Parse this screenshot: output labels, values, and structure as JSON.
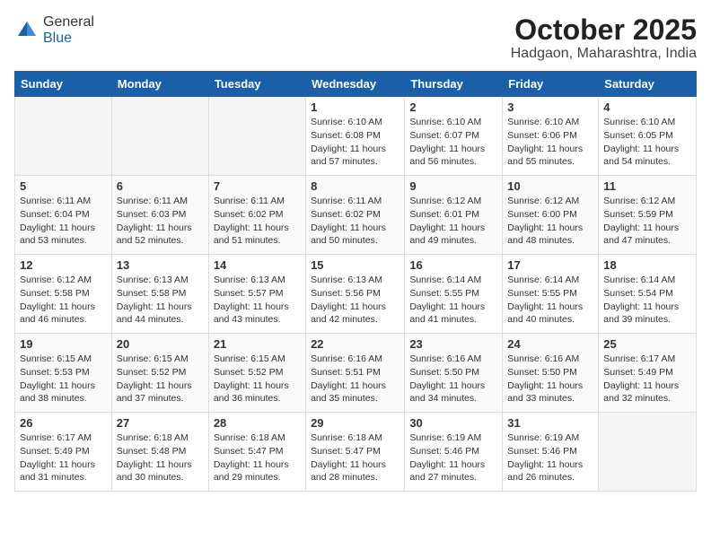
{
  "header": {
    "logo_line1": "General",
    "logo_line2": "Blue",
    "month_title": "October 2025",
    "subtitle": "Hadgaon, Maharashtra, India"
  },
  "weekdays": [
    "Sunday",
    "Monday",
    "Tuesday",
    "Wednesday",
    "Thursday",
    "Friday",
    "Saturday"
  ],
  "weeks": [
    [
      {
        "day": "",
        "info": ""
      },
      {
        "day": "",
        "info": ""
      },
      {
        "day": "",
        "info": ""
      },
      {
        "day": "1",
        "info": "Sunrise: 6:10 AM\nSunset: 6:08 PM\nDaylight: 11 hours and 57 minutes."
      },
      {
        "day": "2",
        "info": "Sunrise: 6:10 AM\nSunset: 6:07 PM\nDaylight: 11 hours and 56 minutes."
      },
      {
        "day": "3",
        "info": "Sunrise: 6:10 AM\nSunset: 6:06 PM\nDaylight: 11 hours and 55 minutes."
      },
      {
        "day": "4",
        "info": "Sunrise: 6:10 AM\nSunset: 6:05 PM\nDaylight: 11 hours and 54 minutes."
      }
    ],
    [
      {
        "day": "5",
        "info": "Sunrise: 6:11 AM\nSunset: 6:04 PM\nDaylight: 11 hours and 53 minutes."
      },
      {
        "day": "6",
        "info": "Sunrise: 6:11 AM\nSunset: 6:03 PM\nDaylight: 11 hours and 52 minutes."
      },
      {
        "day": "7",
        "info": "Sunrise: 6:11 AM\nSunset: 6:02 PM\nDaylight: 11 hours and 51 minutes."
      },
      {
        "day": "8",
        "info": "Sunrise: 6:11 AM\nSunset: 6:02 PM\nDaylight: 11 hours and 50 minutes."
      },
      {
        "day": "9",
        "info": "Sunrise: 6:12 AM\nSunset: 6:01 PM\nDaylight: 11 hours and 49 minutes."
      },
      {
        "day": "10",
        "info": "Sunrise: 6:12 AM\nSunset: 6:00 PM\nDaylight: 11 hours and 48 minutes."
      },
      {
        "day": "11",
        "info": "Sunrise: 6:12 AM\nSunset: 5:59 PM\nDaylight: 11 hours and 47 minutes."
      }
    ],
    [
      {
        "day": "12",
        "info": "Sunrise: 6:12 AM\nSunset: 5:58 PM\nDaylight: 11 hours and 46 minutes."
      },
      {
        "day": "13",
        "info": "Sunrise: 6:13 AM\nSunset: 5:58 PM\nDaylight: 11 hours and 44 minutes."
      },
      {
        "day": "14",
        "info": "Sunrise: 6:13 AM\nSunset: 5:57 PM\nDaylight: 11 hours and 43 minutes."
      },
      {
        "day": "15",
        "info": "Sunrise: 6:13 AM\nSunset: 5:56 PM\nDaylight: 11 hours and 42 minutes."
      },
      {
        "day": "16",
        "info": "Sunrise: 6:14 AM\nSunset: 5:55 PM\nDaylight: 11 hours and 41 minutes."
      },
      {
        "day": "17",
        "info": "Sunrise: 6:14 AM\nSunset: 5:55 PM\nDaylight: 11 hours and 40 minutes."
      },
      {
        "day": "18",
        "info": "Sunrise: 6:14 AM\nSunset: 5:54 PM\nDaylight: 11 hours and 39 minutes."
      }
    ],
    [
      {
        "day": "19",
        "info": "Sunrise: 6:15 AM\nSunset: 5:53 PM\nDaylight: 11 hours and 38 minutes."
      },
      {
        "day": "20",
        "info": "Sunrise: 6:15 AM\nSunset: 5:52 PM\nDaylight: 11 hours and 37 minutes."
      },
      {
        "day": "21",
        "info": "Sunrise: 6:15 AM\nSunset: 5:52 PM\nDaylight: 11 hours and 36 minutes."
      },
      {
        "day": "22",
        "info": "Sunrise: 6:16 AM\nSunset: 5:51 PM\nDaylight: 11 hours and 35 minutes."
      },
      {
        "day": "23",
        "info": "Sunrise: 6:16 AM\nSunset: 5:50 PM\nDaylight: 11 hours and 34 minutes."
      },
      {
        "day": "24",
        "info": "Sunrise: 6:16 AM\nSunset: 5:50 PM\nDaylight: 11 hours and 33 minutes."
      },
      {
        "day": "25",
        "info": "Sunrise: 6:17 AM\nSunset: 5:49 PM\nDaylight: 11 hours and 32 minutes."
      }
    ],
    [
      {
        "day": "26",
        "info": "Sunrise: 6:17 AM\nSunset: 5:49 PM\nDaylight: 11 hours and 31 minutes."
      },
      {
        "day": "27",
        "info": "Sunrise: 6:18 AM\nSunset: 5:48 PM\nDaylight: 11 hours and 30 minutes."
      },
      {
        "day": "28",
        "info": "Sunrise: 6:18 AM\nSunset: 5:47 PM\nDaylight: 11 hours and 29 minutes."
      },
      {
        "day": "29",
        "info": "Sunrise: 6:18 AM\nSunset: 5:47 PM\nDaylight: 11 hours and 28 minutes."
      },
      {
        "day": "30",
        "info": "Sunrise: 6:19 AM\nSunset: 5:46 PM\nDaylight: 11 hours and 27 minutes."
      },
      {
        "day": "31",
        "info": "Sunrise: 6:19 AM\nSunset: 5:46 PM\nDaylight: 11 hours and 26 minutes."
      },
      {
        "day": "",
        "info": ""
      }
    ]
  ]
}
